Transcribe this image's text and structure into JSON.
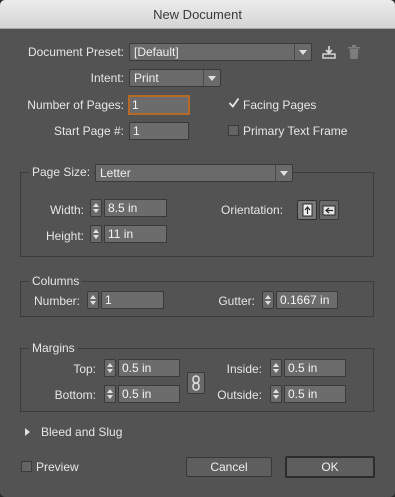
{
  "window": {
    "title": "New Document"
  },
  "preset": {
    "label": "Document Preset:",
    "value": "[Default]"
  },
  "intent": {
    "label": "Intent:",
    "value": "Print"
  },
  "pages": {
    "number_label": "Number of Pages:",
    "number_value": "1",
    "start_label": "Start Page #:",
    "start_value": "1",
    "facing_label": "Facing Pages",
    "facing_checked": true,
    "primary_label": "Primary Text Frame",
    "primary_checked": false
  },
  "page_size": {
    "label": "Page Size:",
    "value": "Letter",
    "width_label": "Width:",
    "width_value": "8.5 in",
    "height_label": "Height:",
    "height_value": "11 in",
    "orientation_label": "Orientation:",
    "orientation_selected": "portrait"
  },
  "columns": {
    "title": "Columns",
    "number_label": "Number:",
    "number_value": "1",
    "gutter_label": "Gutter:",
    "gutter_value": "0.1667 in"
  },
  "margins": {
    "title": "Margins",
    "top_label": "Top:",
    "top_value": "0.5 in",
    "bottom_label": "Bottom:",
    "bottom_value": "0.5 in",
    "inside_label": "Inside:",
    "inside_value": "0.5 in",
    "outside_label": "Outside:",
    "outside_value": "0.5 in"
  },
  "bleed": {
    "label": "Bleed and Slug"
  },
  "footer": {
    "preview_label": "Preview",
    "cancel_label": "Cancel",
    "ok_label": "OK"
  }
}
